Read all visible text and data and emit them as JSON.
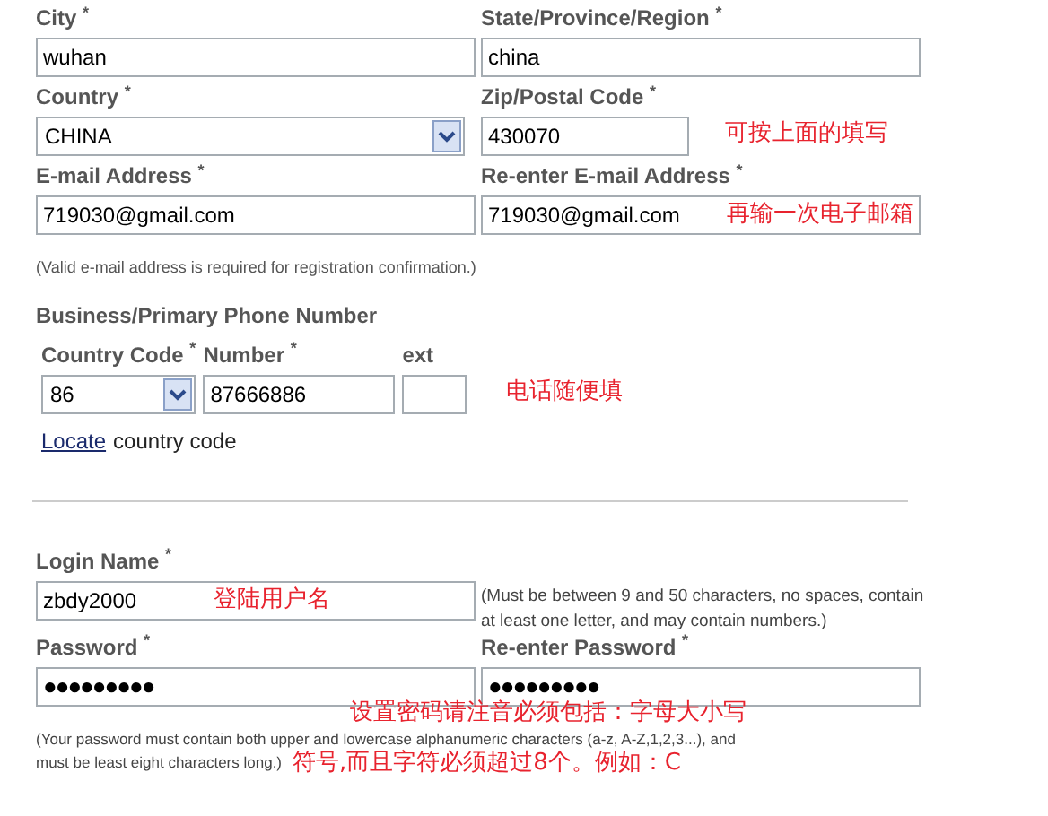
{
  "address": {
    "city": {
      "label": "City $^{*}$",
      "value": "wuhan"
    },
    "state": {
      "label": "State/Province/Region $^{*}$",
      "value": "china"
    },
    "country": {
      "label": "Country $^{*}$",
      "value": "CHINA"
    },
    "zip": {
      "label": "Zip/Postal Code $^{*}$",
      "value": "430070",
      "note": "可按上面的填写"
    },
    "email": {
      "label": "E-mail Address $^{*}$",
      "value": "719030@gmail.com"
    },
    "email_confirm": {
      "label": "Re-enter E-mail Address $^{*}$",
      "value": "719030@gmail.com",
      "note": "再输一次电子邮箱"
    },
    "email_hint": "(Valid e-mail address is required for registration confirmation.)"
  },
  "phone": {
    "title": "Business/Primary Phone Number",
    "country_code": {
      "label": "Country Code $^{*}$",
      "value": "86"
    },
    "number": {
      "label": "Number $^{*}$",
      "value": "87666886"
    },
    "ext": {
      "label": "ext"
    },
    "note": "电话随便填",
    "locate_link": "Locate",
    "locate_text": "country code"
  },
  "login": {
    "login_name": {
      "label": "Login Name $^{*}$",
      "value": "zbdy2000",
      "note": "登陆用户名"
    },
    "login_hint": "(Must be between 9 and 50 characters, no spaces, contain at least one letter, and may contain numbers.)",
    "password": {
      "label": "Password $^{*}$",
      "value": "●●●●●●●●●"
    },
    "password_confirm": {
      "label": "Re-enter Password $^{*}$",
      "value": "●●●●●●●●●"
    },
    "note_line_1": "设置密码请注音必须包括：字母大小写",
    "password_hint_1": "(Your password must contain both upper and lowercase alphanumeric characters (a-z, A-Z,1,2,3...), and",
    "password_hint_2": "must be least eight characters long.)",
    "note_line_2": "符号,而且字符必须超过8个。例如：C"
  }
}
